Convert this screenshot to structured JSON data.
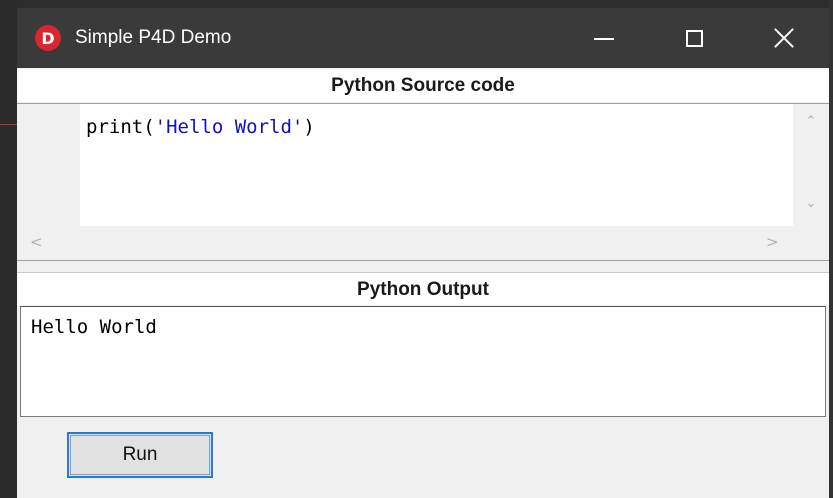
{
  "window": {
    "title": "Simple P4D Demo",
    "icon_letter": "D",
    "icon_color": "#d9262f",
    "controls": [
      "minimize-icon",
      "maximize-icon",
      "close-icon"
    ]
  },
  "source": {
    "header": "Python Source code",
    "code_prefix": "print(",
    "code_string": "'Hello World'",
    "code_suffix": ")"
  },
  "output": {
    "header": "Python Output",
    "text": "Hello World"
  },
  "actions": {
    "run_label": "Run"
  },
  "colors": {
    "accent": "#2b7ad1",
    "string_literal": "#1010c0",
    "titlebar": "#3a3a3a"
  }
}
